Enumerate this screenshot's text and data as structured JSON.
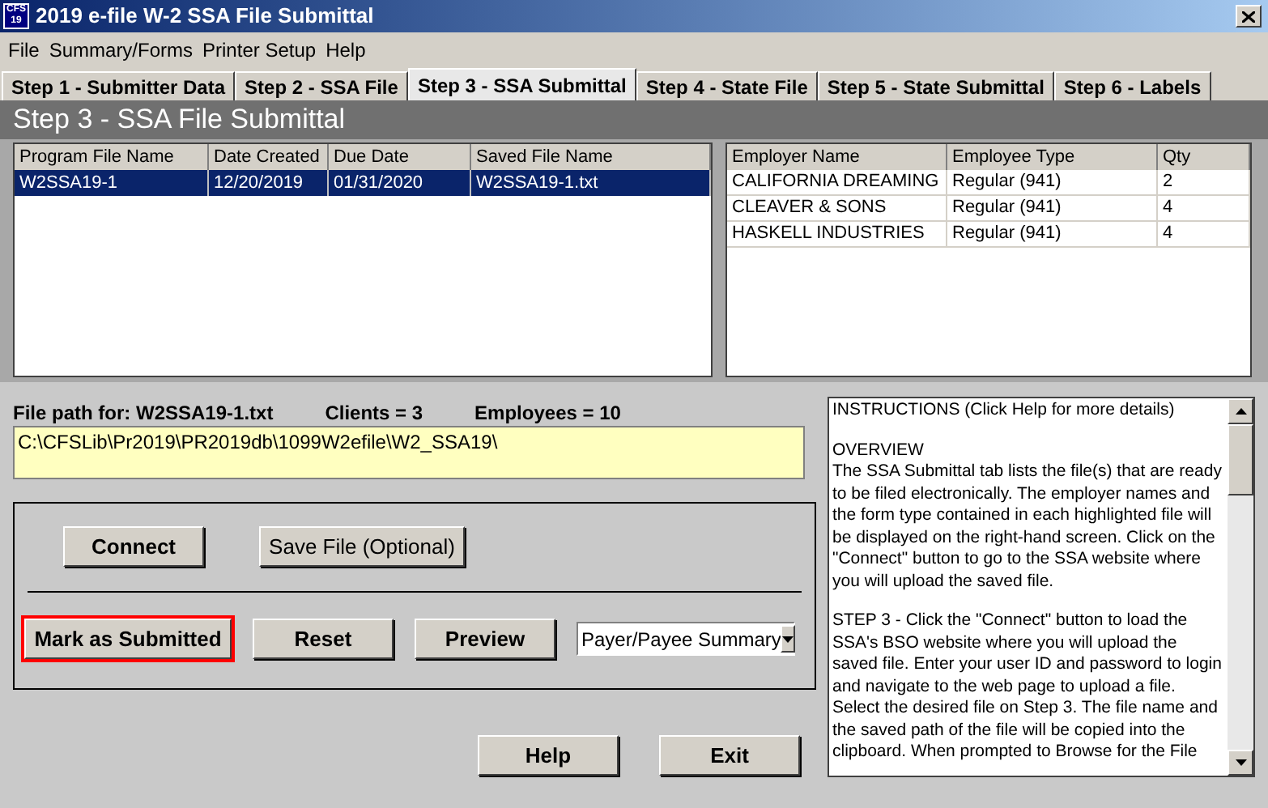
{
  "window": {
    "title": "2019 e-file W-2 SSA File Submittal",
    "icon_text": [
      "CFS",
      "19"
    ]
  },
  "menu": [
    "File",
    "Summary/Forms",
    "Printer Setup",
    "Help"
  ],
  "tabs": [
    {
      "label": "Step 1 - Submitter Data",
      "selected": false
    },
    {
      "label": "Step 2 - SSA File",
      "selected": false
    },
    {
      "label": "Step 3 - SSA Submittal",
      "selected": true
    },
    {
      "label": "Step 4 - State File",
      "selected": false
    },
    {
      "label": "Step 5 - State Submittal",
      "selected": false
    },
    {
      "label": "Step 6 - Labels",
      "selected": false
    }
  ],
  "page_heading": "Step 3 - SSA File Submittal",
  "files_table": {
    "columns": [
      "Program File Name",
      "Date Created",
      "Due Date",
      "Saved File Name"
    ],
    "rows": [
      {
        "cells": [
          "W2SSA19-1",
          "12/20/2019",
          "01/31/2020",
          "W2SSA19-1.txt"
        ],
        "selected": true
      }
    ]
  },
  "employers_table": {
    "columns": [
      "Employer Name",
      "Employee Type",
      "Qty"
    ],
    "rows": [
      {
        "cells": [
          "CALIFORNIA DREAMING",
          "Regular (941)",
          "2"
        ]
      },
      {
        "cells": [
          "CLEAVER & SONS",
          "Regular (941)",
          "4"
        ]
      },
      {
        "cells": [
          "HASKELL INDUSTRIES",
          "Regular (941)",
          "4"
        ]
      }
    ]
  },
  "file_info": {
    "path_label": "File path for: W2SSA19-1.txt",
    "clients": "Clients = 3",
    "employees": "Employees = 10"
  },
  "file_path": {
    "value": "C:\\CFSLib\\Pr2019\\PR2019db\\1099W2efile\\W2_SSA19\\"
  },
  "buttons_top": [
    {
      "label": "Connect",
      "bold": true
    },
    {
      "label": "Save File (Optional)",
      "bold": false
    }
  ],
  "buttons_bottom": [
    {
      "label": "Mark as Submitted",
      "highlighted": true
    },
    {
      "label": "Reset",
      "highlighted": false
    },
    {
      "label": "Preview",
      "highlighted": false
    }
  ],
  "report_select": {
    "value": "Payer/Payee Summary"
  },
  "instructions": [
    [
      "INSTRUCTIONS (Click Help for more details)"
    ],
    [
      "OVERVIEW",
      "The SSA Submittal tab lists the file(s) that are ready to be filed electronically. The employer names and the form type contained in each highlighted file will be displayed on the right-hand screen. Click on the \"Connect\" button to go to the SSA website where you will upload the saved file."
    ],
    [
      "STEP 3 - Click the \"Connect\" button to load the SSA's BSO website where you will upload the saved file.  Enter your user ID and password to login and navigate to the web page to upload a file.  Select the desired file on Step 3.  The file name and the saved path of the file will be copied into the clipboard.  When prompted to Browse for the File"
    ]
  ],
  "footer_buttons": [
    "Help",
    "Exit"
  ]
}
